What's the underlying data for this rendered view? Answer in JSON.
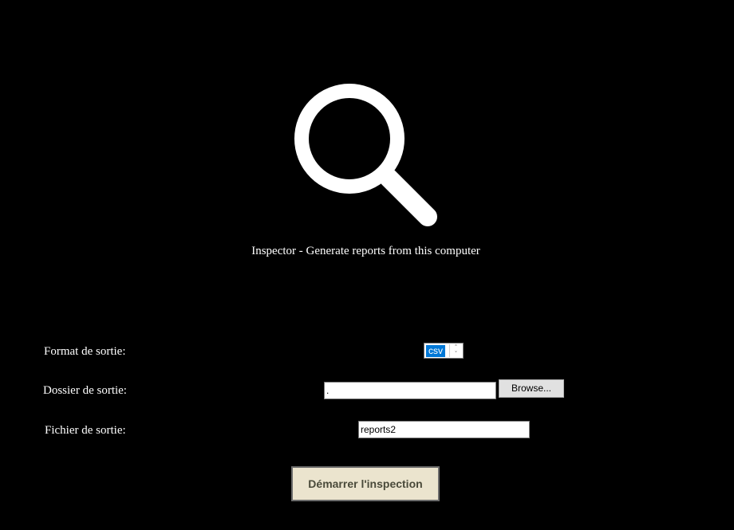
{
  "app": {
    "title": "Inspector - Generate reports from this computer",
    "logo_icon": "magnifying-glass-icon"
  },
  "form": {
    "format_label": "Format de sortie:",
    "format_value": "csv",
    "folder_label": "Dossier de sortie:",
    "folder_value": ".",
    "browse_label": "Browse...",
    "file_label": "Fichier de sortie:",
    "file_value": "reports2",
    "start_label": "Démarrer l'inspection"
  },
  "colors": {
    "background": "#000000",
    "text": "#ffffff",
    "selection": "#0078d7",
    "start_button": "#ebe4ce"
  }
}
